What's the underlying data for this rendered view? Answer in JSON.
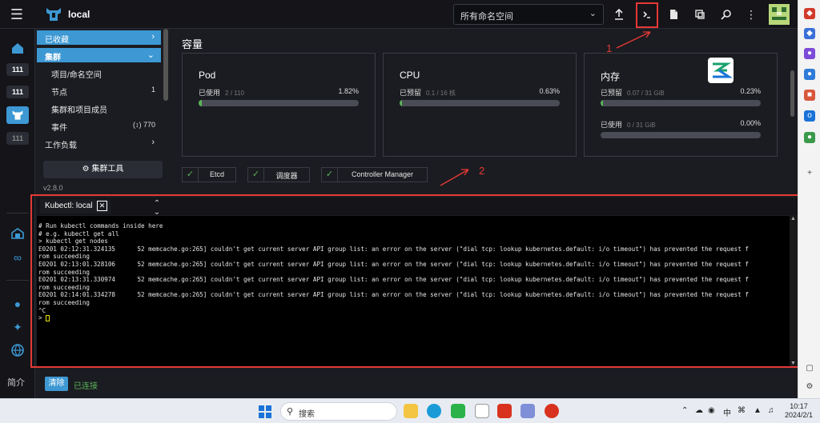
{
  "topbar": {
    "cluster": "local",
    "namespace": "所有命名空间"
  },
  "rail": {
    "chips": [
      "111",
      "111",
      "111"
    ],
    "lang": "简介"
  },
  "sidenav": {
    "favorites": "已收藏",
    "cluster": "集群",
    "items": [
      {
        "label": "项目/命名空间",
        "count": ""
      },
      {
        "label": "节点",
        "count": "1"
      },
      {
        "label": "集群和项目成员",
        "count": ""
      },
      {
        "label": "事件",
        "count": "770"
      }
    ],
    "workload": "工作负载",
    "tools": "集群工具",
    "version": "v2.8.0"
  },
  "capacity": {
    "title": "容量",
    "pod": {
      "title": "Pod",
      "used_label": "已使用",
      "used_sub": "2 / 110",
      "pct": "1.82%",
      "fill": 0.0182
    },
    "cpu": {
      "title": "CPU",
      "reserved_label": "已预留",
      "reserved_sub": "0.1 / 16 核",
      "pct": "0.63%",
      "fill": 0.0063
    },
    "memory": {
      "title": "内存",
      "reserved_label": "已预留",
      "reserved_sub": "0.07 / 31 GiB",
      "reserved_pct": "0.23%",
      "reserved_fill": 0.0023,
      "used_label": "已使用",
      "used_sub": "0 / 31 GiB",
      "used_pct": "0.00%",
      "used_fill": 0
    }
  },
  "components": [
    "Etcd",
    "调度器",
    "Controller Manager"
  ],
  "annotations": {
    "one": "1",
    "two": "2"
  },
  "terminal": {
    "tab": "Kubectl: local",
    "lines": [
      "# Run kubectl commands inside here",
      "# e.g. kubectl get all",
      "> kubectl get nodes",
      "E0201 02:12:31.324135      52 memcache.go:265] couldn't get current server API group list: an error on the server (\"dial tcp: lookup kubernetes.default: i/o timeout\") has prevented the request f",
      "rom succeeding",
      "E0201 02:13:01.328106      52 memcache.go:265] couldn't get current server API group list: an error on the server (\"dial tcp: lookup kubernetes.default: i/o timeout\") has prevented the request f",
      "rom succeeding",
      "E0201 02:13:31.330974      52 memcache.go:265] couldn't get current server API group list: an error on the server (\"dial tcp: lookup kubernetes.default: i/o timeout\") has prevented the request f",
      "rom succeeding",
      "E0201 02:14:01.334278      52 memcache.go:265] couldn't get current server API group list: an error on the server (\"dial tcp: lookup kubernetes.default: i/o timeout\") has prevented the request f",
      "rom succeeding",
      "^C"
    ],
    "prompt": "> "
  },
  "footer": {
    "clear": "清除",
    "status": "已连接"
  },
  "taskbar": {
    "search": "搜索",
    "tray_lang": "中",
    "time": "10:17",
    "date": "2024/2/1"
  },
  "colors": {
    "accent": "#3d98d3",
    "ok": "#5ab35a",
    "annotation": "#e53935"
  }
}
